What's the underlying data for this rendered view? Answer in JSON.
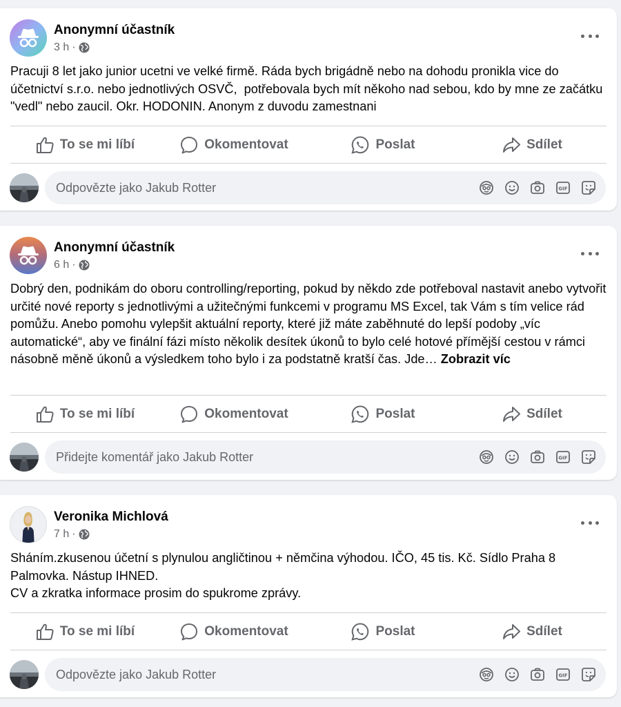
{
  "posts": [
    {
      "author": "Anonymní účastník",
      "time": "3 h",
      "separator": "·",
      "text": "Pracuji 8 let jako junior ucetni ve velké firmě. Ráda bych brigádně nebo na dohodu pronikla vice do účetnictví s.r.o. nebo jednotlivých OSVČ,  potřebovala bych mít někoho nad sebou, kdo by mne ze začátku \"vedl\" nebo zaucil. Okr. HODONIN. Anonym z duvodu zamestnani",
      "see_more": "",
      "actions": {
        "like": "To se mi líbí",
        "comment": "Okomentovat",
        "send": "Poslat",
        "share": "Sdílet"
      },
      "comment_placeholder": "Odpovězte jako Jakub Rotter"
    },
    {
      "author": "Anonymní účastník",
      "time": "6 h",
      "separator": "·",
      "text": "Dobrý den, podnikám do oboru controlling/reporting, pokud by někdo zde potřeboval nastavit anebo vytvořit určité nové reporty s jednotlivými a užitečnými funkcemi v programu MS Excel, tak Vám s tím velice rád pomůžu. Anebo pomohu vylepšit aktuální reporty, které již máte zaběhnuté do lepší podoby „víc automatické“, aby ve finální fázi místo několik desítek úkonů to bylo celé hotové přímější cestou v rámci násobně měně úkonů a výsledkem toho bylo i za podstatně kratší čas. Jde… ",
      "see_more": "Zobrazit víc",
      "actions": {
        "like": "To se mi líbí",
        "comment": "Okomentovat",
        "send": "Poslat",
        "share": "Sdílet"
      },
      "comment_placeholder": "Přidejte komentář jako Jakub Rotter"
    },
    {
      "author": "Veronika Michlová",
      "time": "7 h",
      "separator": "·",
      "text": "Sháním.zkusenou účetní s plynulou angličtinou + němčina výhodou. IČO, 45 tis. Kč. Sídlo Praha 8 Palmovka. Nástup IHNED.\nCV a zkratka informace prosim do spukrome zprávy.",
      "see_more": "",
      "actions": {
        "like": "To se mi líbí",
        "comment": "Okomentovat",
        "send": "Poslat",
        "share": "Sdílet"
      },
      "comment_placeholder": "Odpovězte jako Jakub Rotter"
    }
  ],
  "icons": {
    "privacy": "globe-icon",
    "more": "more-options-icon",
    "like": "thumbs-up-icon",
    "comment": "comment-bubble-icon",
    "send": "whatsapp-icon",
    "share": "share-arrow-icon",
    "comment_tools": [
      "avatar-sticker-icon",
      "emoji-icon",
      "camera-icon",
      "gif-icon",
      "sticker-icon"
    ]
  },
  "colors": {
    "background": "#f0f2f5",
    "card": "#ffffff",
    "primary_text": "#050505",
    "secondary_text": "#65676b",
    "divider": "#ced0d4"
  }
}
